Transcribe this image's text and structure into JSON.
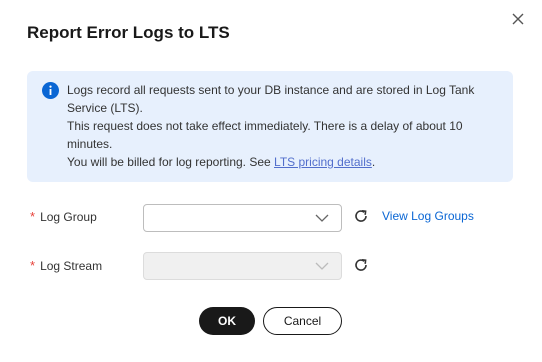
{
  "dialog": {
    "title": "Report Error Logs to LTS",
    "close_icon": "close-icon"
  },
  "info": {
    "icon": "info-icon",
    "line1": "Logs record all requests sent to your DB instance and are stored in Log Tank Service (LTS).",
    "line2": "This request does not take effect immediately. There is a delay of about 10 minutes.",
    "line3_prefix": "You will be billed for log reporting. See ",
    "line3_link": "LTS pricing details",
    "line3_suffix": ".",
    "colors": {
      "background": "#e7f0fd",
      "icon": "#0a66d4",
      "link": "#526ecc"
    }
  },
  "form": {
    "required_mark": "*",
    "log_group": {
      "label": "Log Group",
      "value": "",
      "refresh_icon": "refresh-icon",
      "view_link": "View Log Groups"
    },
    "log_stream": {
      "label": "Log Stream",
      "value": "",
      "disabled": true,
      "refresh_icon": "refresh-icon"
    }
  },
  "buttons": {
    "ok": "OK",
    "cancel": "Cancel"
  }
}
